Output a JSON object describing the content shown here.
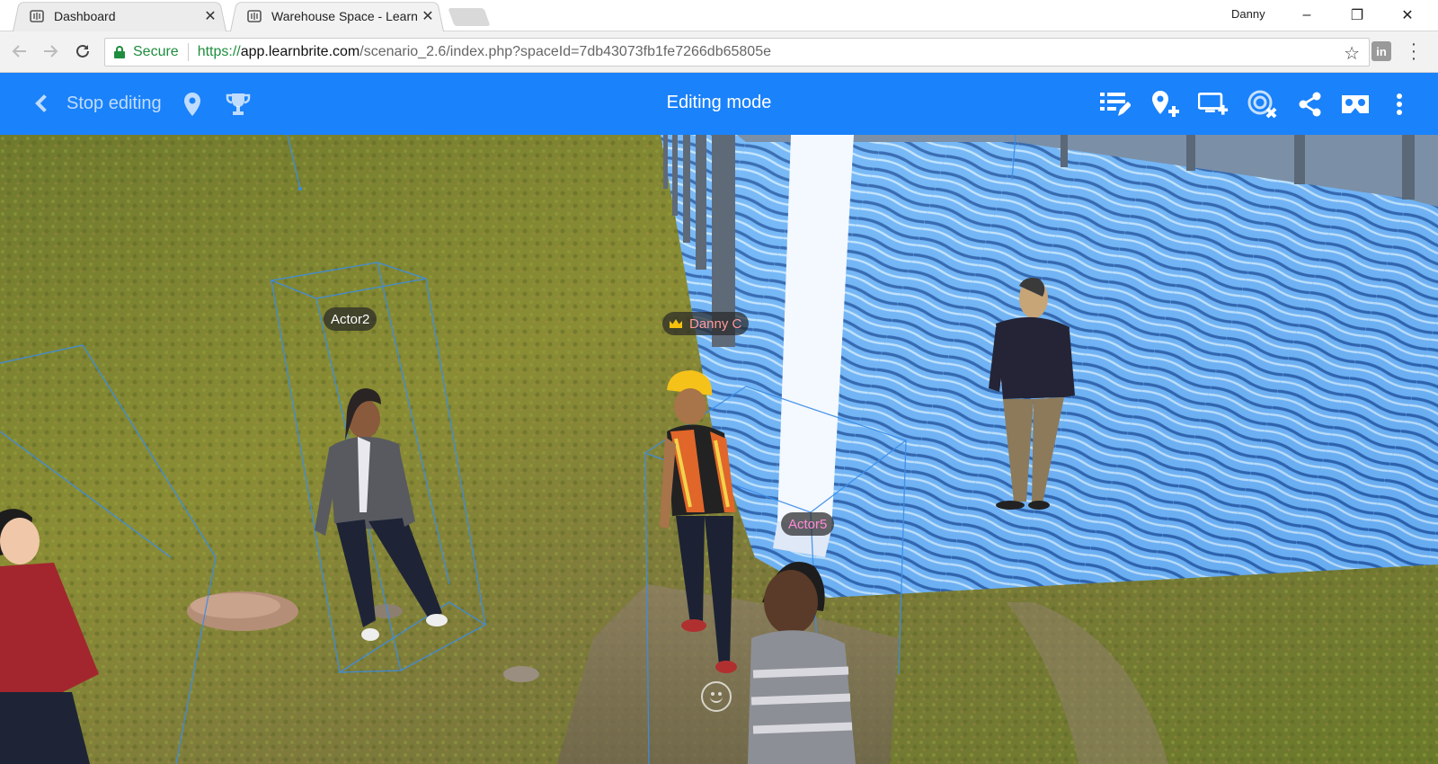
{
  "browser": {
    "tabs": [
      {
        "title": "Dashboard",
        "icon": "learnbrite-favicon",
        "active": false
      },
      {
        "title": "Warehouse Space - Learn",
        "icon": "learnbrite-favicon",
        "active": true
      }
    ],
    "profile_name": "Danny",
    "window_controls": {
      "minimize": "–",
      "restore": "❐",
      "close": "✕"
    },
    "address_bar": {
      "security_label": "Secure",
      "url_scheme": "https://",
      "url_host": "app.learnbrite.com",
      "url_path": "/scenario_2.6/index.php?spaceId=7db43073fb1fe7266db65805e"
    },
    "extension_label": "in"
  },
  "app_header": {
    "stop_editing_label": "Stop editing",
    "title": "Editing mode",
    "left_icons": [
      "location-pin-icon",
      "trophy-icon"
    ],
    "right_icons": [
      "edit-list-icon",
      "add-location-icon",
      "add-screen-icon",
      "remove-target-icon",
      "share-icon",
      "vr-headset-icon",
      "more-vertical-icon"
    ],
    "accent_color": "#1a82fb"
  },
  "scene": {
    "labels": {
      "actor2": "Actor2",
      "danny": "Danny C",
      "actor5": "Actor5"
    },
    "label_colors": {
      "actor2": "#ffffff",
      "danny": "#ff9a9a",
      "actor5": "#ff8ad8"
    }
  }
}
